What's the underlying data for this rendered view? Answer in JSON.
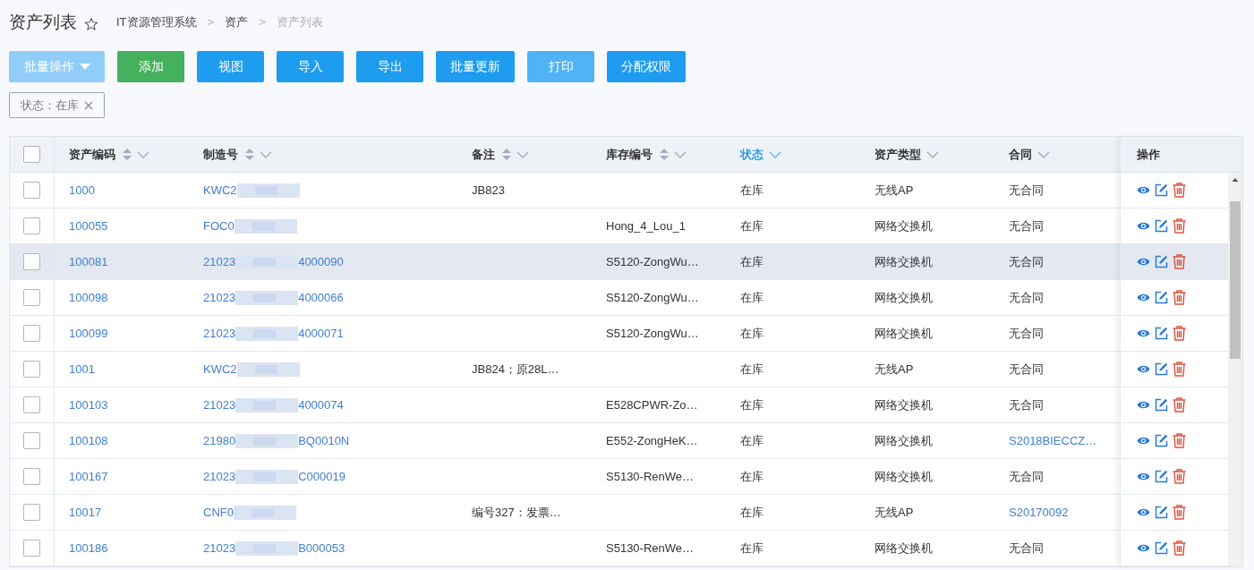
{
  "page": {
    "title": "资产列表",
    "breadcrumbs": [
      {
        "label": "IT资源管理系统",
        "current": false
      },
      {
        "label": "资产",
        "current": false
      },
      {
        "label": "资产列表",
        "current": true
      }
    ]
  },
  "breadcrumb_separators": [
    ">",
    ">"
  ],
  "toolbar": [
    {
      "label": "批量操作",
      "kind": "disabled",
      "dropdown": true
    },
    {
      "label": "添加",
      "kind": "success",
      "dropdown": false
    },
    {
      "label": "视图",
      "kind": "primary",
      "dropdown": false
    },
    {
      "label": "导入",
      "kind": "primary",
      "dropdown": false
    },
    {
      "label": "导出",
      "kind": "primary",
      "dropdown": false
    },
    {
      "label": "批量更新",
      "kind": "primary",
      "dropdown": false
    },
    {
      "label": "打印",
      "kind": "light",
      "dropdown": false
    },
    {
      "label": "分配权限",
      "kind": "primary",
      "dropdown": false
    }
  ],
  "filters": [
    {
      "label": "状态：在库"
    }
  ],
  "table": {
    "columns": [
      {
        "label": "资产编码",
        "sortable": true,
        "active": false
      },
      {
        "label": "制造号",
        "sortable": true,
        "active": false
      },
      {
        "label": "备注",
        "sortable": true,
        "active": false
      },
      {
        "label": "库存编号",
        "sortable": true,
        "active": false
      },
      {
        "label": "状态",
        "sortable": false,
        "active": true
      },
      {
        "label": "资产类型",
        "sortable": false,
        "active": false
      },
      {
        "label": "合同",
        "sortable": false,
        "active": false
      }
    ],
    "actions_header": "操作",
    "all_checked": false,
    "rows": [
      {
        "checked": false,
        "highlighted": false,
        "code": "1000",
        "serial_start": "KWC2",
        "serial_end": "",
        "note": "JB823",
        "stock": "",
        "status": "在库",
        "type": "无线AP",
        "contract": "无合同",
        "contract_linked": false
      },
      {
        "checked": false,
        "highlighted": false,
        "code": "100055",
        "serial_start": "FOC0",
        "serial_end": "",
        "note": "",
        "stock": "Hong_4_Lou_1",
        "status": "在库",
        "type": "网络交换机",
        "contract": "无合同",
        "contract_linked": false
      },
      {
        "checked": false,
        "highlighted": true,
        "code": "100081",
        "serial_start": "21023",
        "serial_end": "4000090",
        "note": "",
        "stock": "S5120-ZongWu…",
        "status": "在库",
        "type": "网络交换机",
        "contract": "无合同",
        "contract_linked": false
      },
      {
        "checked": false,
        "highlighted": false,
        "code": "100098",
        "serial_start": "21023",
        "serial_end": "4000066",
        "note": "",
        "stock": "S5120-ZongWu…",
        "status": "在库",
        "type": "网络交换机",
        "contract": "无合同",
        "contract_linked": false
      },
      {
        "checked": false,
        "highlighted": false,
        "code": "100099",
        "serial_start": "21023",
        "serial_end": "4000071",
        "note": "",
        "stock": "S5120-ZongWu…",
        "status": "在库",
        "type": "网络交换机",
        "contract": "无合同",
        "contract_linked": false
      },
      {
        "checked": false,
        "highlighted": false,
        "code": "1001",
        "serial_start": "KWC2",
        "serial_end": "",
        "note": "JB824；原28L…",
        "stock": "",
        "status": "在库",
        "type": "无线AP",
        "contract": "无合同",
        "contract_linked": false
      },
      {
        "checked": false,
        "highlighted": false,
        "code": "100103",
        "serial_start": "21023",
        "serial_end": "4000074",
        "note": "",
        "stock": "E528CPWR-Zo…",
        "status": "在库",
        "type": "网络交换机",
        "contract": "无合同",
        "contract_linked": false
      },
      {
        "checked": false,
        "highlighted": false,
        "code": "100108",
        "serial_start": "21980",
        "serial_end": "BQ0010N",
        "note": "",
        "stock": "E552-ZongHeK…",
        "status": "在库",
        "type": "网络交换机",
        "contract": "S2018BIECCZ…",
        "contract_linked": true
      },
      {
        "checked": false,
        "highlighted": false,
        "code": "100167",
        "serial_start": "21023",
        "serial_end": "C000019",
        "note": "",
        "stock": "S5130-RenWe…",
        "status": "在库",
        "type": "网络交换机",
        "contract": "无合同",
        "contract_linked": false
      },
      {
        "checked": false,
        "highlighted": false,
        "code": "10017",
        "serial_start": "CNF0",
        "serial_end": "",
        "note": "编号327：发票…",
        "stock": "",
        "status": "在库",
        "type": "无线AP",
        "contract": "S20170092",
        "contract_linked": true
      },
      {
        "checked": false,
        "highlighted": false,
        "code": "100186",
        "serial_start": "21023",
        "serial_end": "B000053",
        "note": "",
        "stock": "S5130-RenWe…",
        "status": "在库",
        "type": "网络交换机",
        "contract": "无合同",
        "contract_linked": false
      }
    ]
  }
}
